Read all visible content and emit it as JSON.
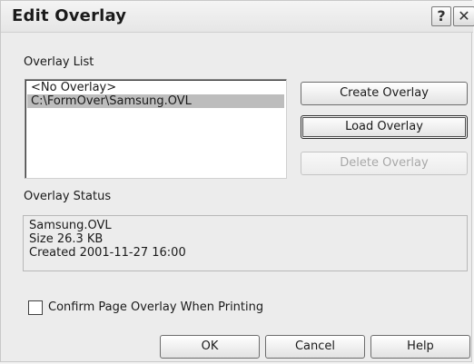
{
  "window": {
    "title": "Edit Overlay",
    "help_glyph": "?",
    "close_glyph": "✕"
  },
  "overlay_list": {
    "label": "Overlay List",
    "items": [
      {
        "label": "<No Overlay>",
        "selected": false
      },
      {
        "label": "C:\\FormOver\\Samsung.OVL",
        "selected": true
      }
    ]
  },
  "buttons": {
    "create": "Create Overlay",
    "load": "Load Overlay",
    "delete": "Delete Overlay",
    "ok": "OK",
    "cancel": "Cancel",
    "help": "Help"
  },
  "overlay_status": {
    "label": "Overlay Status",
    "lines": [
      "Samsung.OVL",
      "Size 26.3 KB",
      "Created 2001-11-27 16:00"
    ]
  },
  "confirm_checkbox": {
    "label": "Confirm Page Overlay When Printing",
    "checked": false
  },
  "icons": [
    "help-icon",
    "close-icon"
  ]
}
